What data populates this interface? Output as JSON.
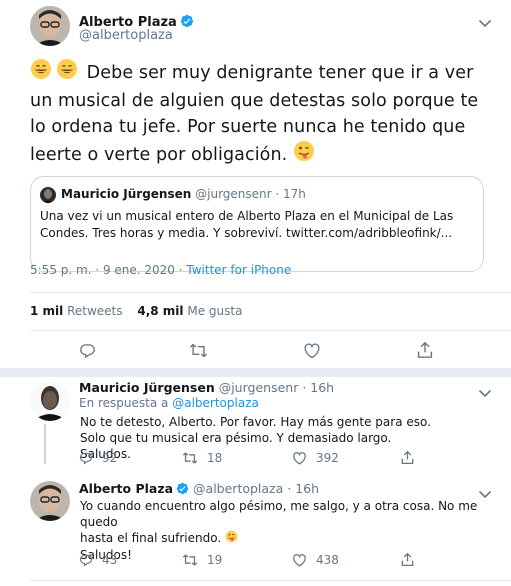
{
  "main_tweet": {
    "author_name": "Alberto Plaza",
    "author_handle": "@albertoplaza",
    "text": "Debe ser muy denigrante tener que ir a ver un musical de alguien que detestas solo porque te lo ordena tu jefe. Por suerte nunca he tenido que leerte o verte por obligación.",
    "timestamp": "5:55 p. m. · 9 ene. 2020 · ",
    "source": "Twitter for iPhone",
    "retweets_count": "1 mil",
    "retweets_label": "Retweets",
    "likes_count": "4,8 mil",
    "likes_label": "Me gusta"
  },
  "quoted_tweet": {
    "author_name": "Mauricio Jürgensen",
    "author_handle": "@jurgensenr",
    "time": "· 17h",
    "text": "Una vez vi un musical entero de Alberto Plaza en el Municipal de Las Condes. Tres horas y media. Y sobreviví. twitter.com/adribbleofink/..."
  },
  "replies": [
    {
      "author_name": "Mauricio Jürgensen",
      "author_handle": "@jurgensenr",
      "time": "· 16h",
      "reply_to_prefix": "En respuesta a ",
      "reply_to": "@albertoplaza",
      "text": "No te detesto, Alberto. Por favor. Hay más gente para eso. Solo que tu musical era pésimo. Y demasiado largo. Saludos.",
      "replies": "92",
      "retweets": "18",
      "likes": "392"
    },
    {
      "author_name": "Alberto Plaza",
      "author_handle": "@albertoplaza",
      "time": "· 16h",
      "text_line1": "Yo cuando encuentro algo pésimo, me salgo, y a otra cosa. No me quedo",
      "text_line2": "hasta el final sufriendo.",
      "text_line3": "Saludos!",
      "replies": "43",
      "retweets": "19",
      "likes": "438"
    }
  ],
  "colors": {
    "accent": "#1da1f2",
    "muted": "#657786",
    "border": "#e6ecf0"
  },
  "icons": [
    "verified-badge-icon",
    "chevron-down-icon",
    "reply-icon",
    "retweet-icon",
    "like-icon",
    "share-icon",
    "grinning-emoji",
    "winking-tongue-emoji"
  ]
}
